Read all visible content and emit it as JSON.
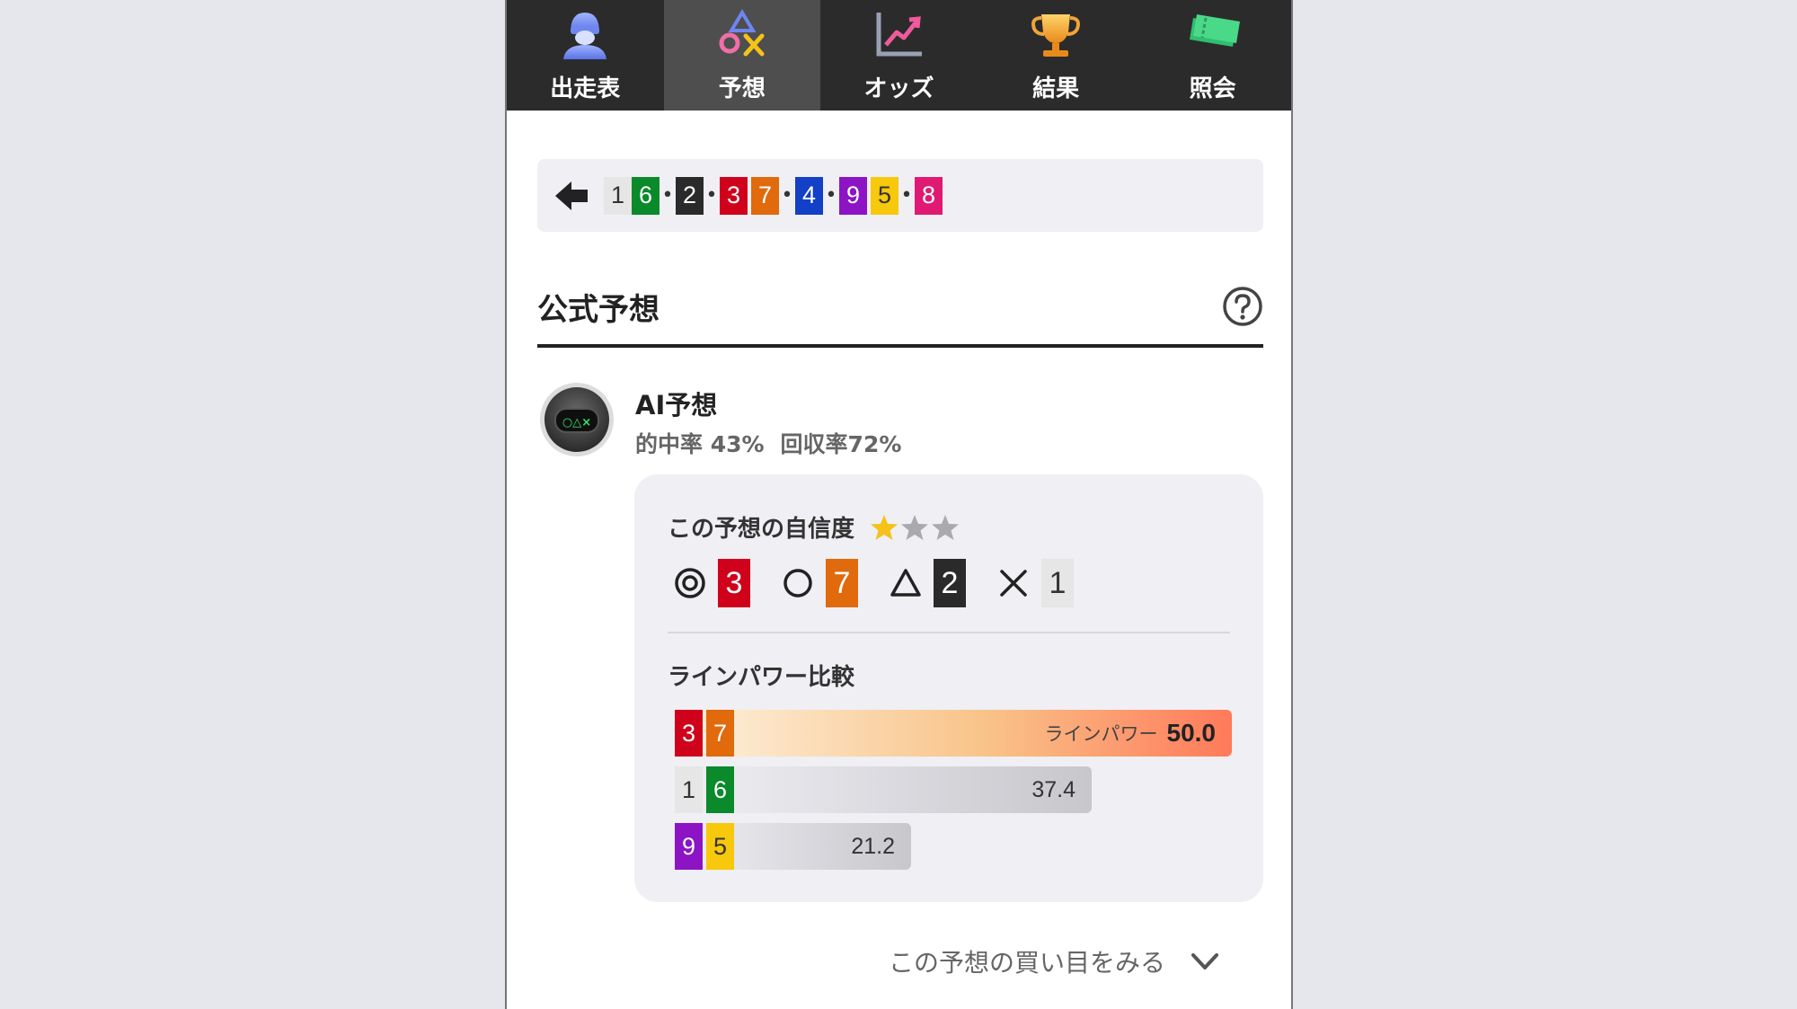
{
  "nav": {
    "items": [
      {
        "label": "出走表",
        "icon": "racer-icon",
        "active": false
      },
      {
        "label": "予想",
        "icon": "prediction-marks-icon",
        "active": true
      },
      {
        "label": "オッズ",
        "icon": "chart-up-icon",
        "active": false
      },
      {
        "label": "結果",
        "icon": "trophy-icon",
        "active": false
      },
      {
        "label": "照会",
        "icon": "ticket-icon",
        "active": false
      }
    ]
  },
  "race_bar": {
    "back_icon": "back-arrow-icon",
    "groups": [
      [
        "1",
        "6"
      ],
      [
        "2"
      ],
      [
        "3",
        "7"
      ],
      [
        "4"
      ],
      [
        "9",
        "5"
      ],
      [
        "8"
      ]
    ]
  },
  "section": {
    "title": "公式予想",
    "help_icon": "help-icon"
  },
  "ai": {
    "name": "AI予想",
    "hit_rate": "的中率 43%",
    "return_rate": "回収率72%",
    "avatar_icon": "ai-robot-icon",
    "avatar_text": "○△×"
  },
  "card": {
    "confidence_label": "この予想の自信度",
    "confidence_stars": 1,
    "confidence_max": 3,
    "marks": [
      {
        "symbol": "◎",
        "number": "3"
      },
      {
        "symbol": "○",
        "number": "7"
      },
      {
        "symbol": "△",
        "number": "2"
      },
      {
        "symbol": "×",
        "number": "1"
      }
    ],
    "line_power_title": "ラインパワー比較",
    "line_power_label": "ラインパワー",
    "lines": [
      {
        "frames": [
          "3",
          "7"
        ],
        "value": "50.0",
        "fraction": 1.0,
        "highlight": true
      },
      {
        "frames": [
          "1",
          "6"
        ],
        "value": "37.4",
        "fraction": 0.748,
        "highlight": false
      },
      {
        "frames": [
          "9",
          "5"
        ],
        "value": "21.2",
        "fraction": 0.424,
        "highlight": false
      }
    ]
  },
  "more": {
    "label": "この予想の買い目をみる",
    "icon": "chevron-down-icon"
  },
  "colors": {
    "nav_bg": "#2b2b2b",
    "nav_active": "#4e4e4e",
    "frame_1": "#e6e6e6",
    "frame_2": "#2a2a2a",
    "frame_3": "#d0021b",
    "frame_4": "#1240c6",
    "frame_5": "#f7c80b",
    "frame_6": "#0a8a2a",
    "frame_7": "#e06a0c",
    "frame_8": "#e01a73",
    "frame_9": "#8c14c4",
    "star_on": "#f5c21a",
    "star_off": "#a9a9ae"
  }
}
